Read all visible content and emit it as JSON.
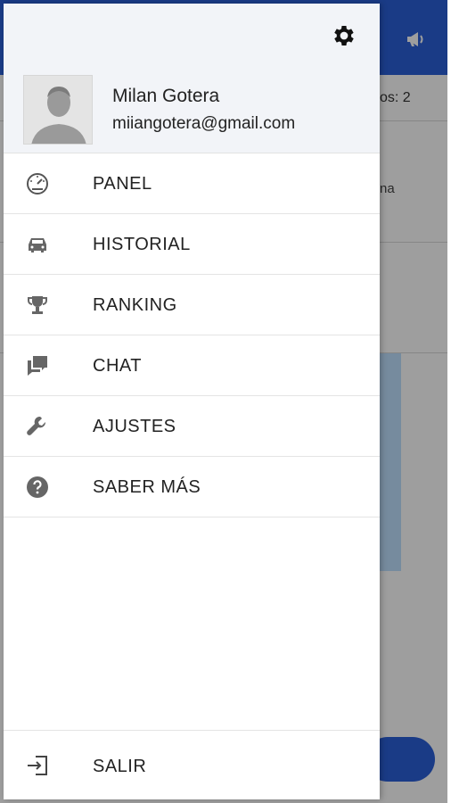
{
  "background": {
    "topbar_color": "#2b5fd9",
    "partial_row_text": "os: 2",
    "partial_row2_text": "na"
  },
  "drawer": {
    "user": {
      "name": "Milan Gotera",
      "email": "miiangotera@gmail.com"
    },
    "settings_icon": "gear-icon",
    "menu": [
      {
        "label": "PANEL",
        "icon": "speedometer-icon"
      },
      {
        "label": "HISTORIAL",
        "icon": "car-icon"
      },
      {
        "label": "RANKING",
        "icon": "trophy-icon"
      },
      {
        "label": "CHAT",
        "icon": "chat-icon"
      },
      {
        "label": "AJUSTES",
        "icon": "wrench-icon"
      },
      {
        "label": "SABER MÁS",
        "icon": "help-icon"
      }
    ],
    "logout": {
      "label": "SALIR",
      "icon": "logout-icon"
    }
  }
}
